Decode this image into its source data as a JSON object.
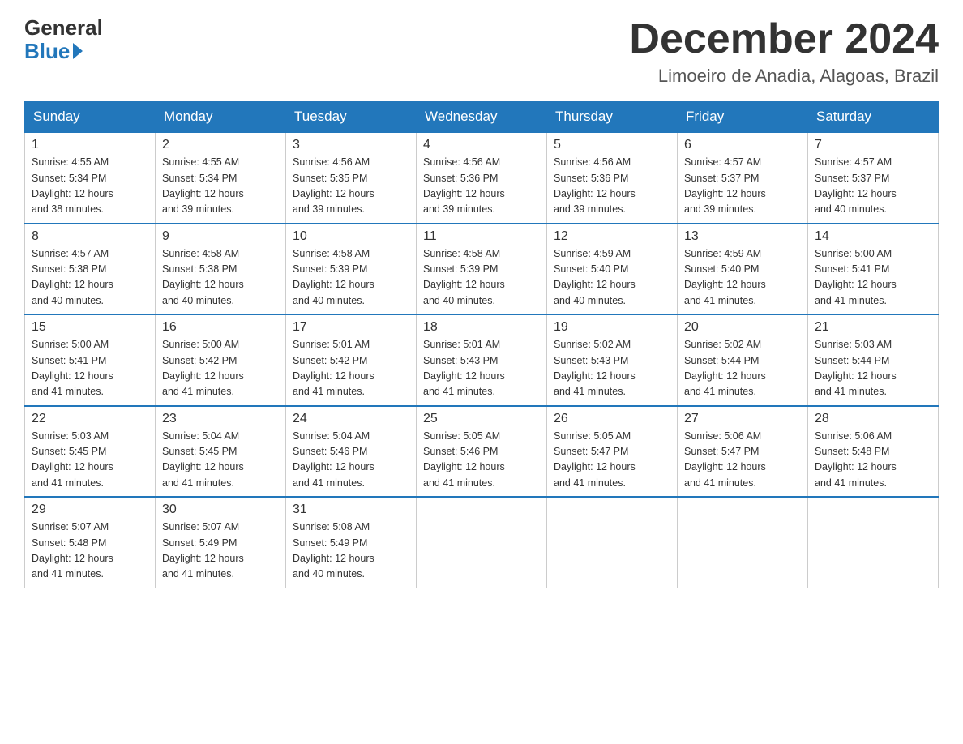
{
  "header": {
    "logo_general": "General",
    "logo_blue": "Blue",
    "month_year": "December 2024",
    "location": "Limoeiro de Anadia, Alagoas, Brazil"
  },
  "days_of_week": [
    "Sunday",
    "Monday",
    "Tuesday",
    "Wednesday",
    "Thursday",
    "Friday",
    "Saturday"
  ],
  "weeks": [
    [
      {
        "day": "1",
        "sunrise": "4:55 AM",
        "sunset": "5:34 PM",
        "daylight": "12 hours and 38 minutes."
      },
      {
        "day": "2",
        "sunrise": "4:55 AM",
        "sunset": "5:34 PM",
        "daylight": "12 hours and 39 minutes."
      },
      {
        "day": "3",
        "sunrise": "4:56 AM",
        "sunset": "5:35 PM",
        "daylight": "12 hours and 39 minutes."
      },
      {
        "day": "4",
        "sunrise": "4:56 AM",
        "sunset": "5:36 PM",
        "daylight": "12 hours and 39 minutes."
      },
      {
        "day": "5",
        "sunrise": "4:56 AM",
        "sunset": "5:36 PM",
        "daylight": "12 hours and 39 minutes."
      },
      {
        "day": "6",
        "sunrise": "4:57 AM",
        "sunset": "5:37 PM",
        "daylight": "12 hours and 39 minutes."
      },
      {
        "day": "7",
        "sunrise": "4:57 AM",
        "sunset": "5:37 PM",
        "daylight": "12 hours and 40 minutes."
      }
    ],
    [
      {
        "day": "8",
        "sunrise": "4:57 AM",
        "sunset": "5:38 PM",
        "daylight": "12 hours and 40 minutes."
      },
      {
        "day": "9",
        "sunrise": "4:58 AM",
        "sunset": "5:38 PM",
        "daylight": "12 hours and 40 minutes."
      },
      {
        "day": "10",
        "sunrise": "4:58 AM",
        "sunset": "5:39 PM",
        "daylight": "12 hours and 40 minutes."
      },
      {
        "day": "11",
        "sunrise": "4:58 AM",
        "sunset": "5:39 PM",
        "daylight": "12 hours and 40 minutes."
      },
      {
        "day": "12",
        "sunrise": "4:59 AM",
        "sunset": "5:40 PM",
        "daylight": "12 hours and 40 minutes."
      },
      {
        "day": "13",
        "sunrise": "4:59 AM",
        "sunset": "5:40 PM",
        "daylight": "12 hours and 41 minutes."
      },
      {
        "day": "14",
        "sunrise": "5:00 AM",
        "sunset": "5:41 PM",
        "daylight": "12 hours and 41 minutes."
      }
    ],
    [
      {
        "day": "15",
        "sunrise": "5:00 AM",
        "sunset": "5:41 PM",
        "daylight": "12 hours and 41 minutes."
      },
      {
        "day": "16",
        "sunrise": "5:00 AM",
        "sunset": "5:42 PM",
        "daylight": "12 hours and 41 minutes."
      },
      {
        "day": "17",
        "sunrise": "5:01 AM",
        "sunset": "5:42 PM",
        "daylight": "12 hours and 41 minutes."
      },
      {
        "day": "18",
        "sunrise": "5:01 AM",
        "sunset": "5:43 PM",
        "daylight": "12 hours and 41 minutes."
      },
      {
        "day": "19",
        "sunrise": "5:02 AM",
        "sunset": "5:43 PM",
        "daylight": "12 hours and 41 minutes."
      },
      {
        "day": "20",
        "sunrise": "5:02 AM",
        "sunset": "5:44 PM",
        "daylight": "12 hours and 41 minutes."
      },
      {
        "day": "21",
        "sunrise": "5:03 AM",
        "sunset": "5:44 PM",
        "daylight": "12 hours and 41 minutes."
      }
    ],
    [
      {
        "day": "22",
        "sunrise": "5:03 AM",
        "sunset": "5:45 PM",
        "daylight": "12 hours and 41 minutes."
      },
      {
        "day": "23",
        "sunrise": "5:04 AM",
        "sunset": "5:45 PM",
        "daylight": "12 hours and 41 minutes."
      },
      {
        "day": "24",
        "sunrise": "5:04 AM",
        "sunset": "5:46 PM",
        "daylight": "12 hours and 41 minutes."
      },
      {
        "day": "25",
        "sunrise": "5:05 AM",
        "sunset": "5:46 PM",
        "daylight": "12 hours and 41 minutes."
      },
      {
        "day": "26",
        "sunrise": "5:05 AM",
        "sunset": "5:47 PM",
        "daylight": "12 hours and 41 minutes."
      },
      {
        "day": "27",
        "sunrise": "5:06 AM",
        "sunset": "5:47 PM",
        "daylight": "12 hours and 41 minutes."
      },
      {
        "day": "28",
        "sunrise": "5:06 AM",
        "sunset": "5:48 PM",
        "daylight": "12 hours and 41 minutes."
      }
    ],
    [
      {
        "day": "29",
        "sunrise": "5:07 AM",
        "sunset": "5:48 PM",
        "daylight": "12 hours and 41 minutes."
      },
      {
        "day": "30",
        "sunrise": "5:07 AM",
        "sunset": "5:49 PM",
        "daylight": "12 hours and 41 minutes."
      },
      {
        "day": "31",
        "sunrise": "5:08 AM",
        "sunset": "5:49 PM",
        "daylight": "12 hours and 40 minutes."
      },
      null,
      null,
      null,
      null
    ]
  ]
}
